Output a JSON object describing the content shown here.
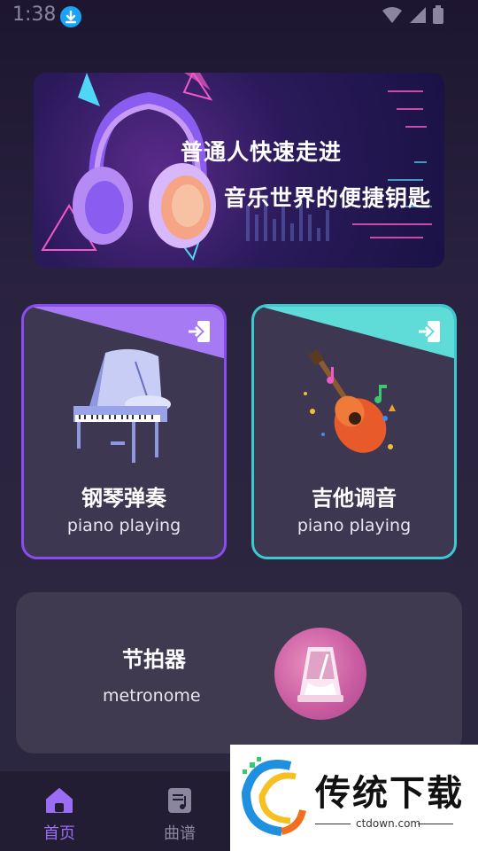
{
  "status_bar": {
    "time": "1:38"
  },
  "banner": {
    "line1": "普通人快速走进",
    "line2": "音乐世界的便捷钥匙"
  },
  "cards": {
    "piano": {
      "title": "钢琴弹奏",
      "subtitle": "piano playing"
    },
    "guitar": {
      "title": "吉他调音",
      "subtitle": "piano playing"
    }
  },
  "metronome": {
    "title": "节拍器",
    "subtitle": "metronome"
  },
  "nav": {
    "home": "首页",
    "score": "曲谱"
  },
  "watermark": {
    "text": "传统下载",
    "url": "ctdown.com"
  },
  "colors": {
    "accent": "#8a4cf0",
    "teal": "#3ec8d0",
    "nav_active": "#9b6cf5"
  }
}
